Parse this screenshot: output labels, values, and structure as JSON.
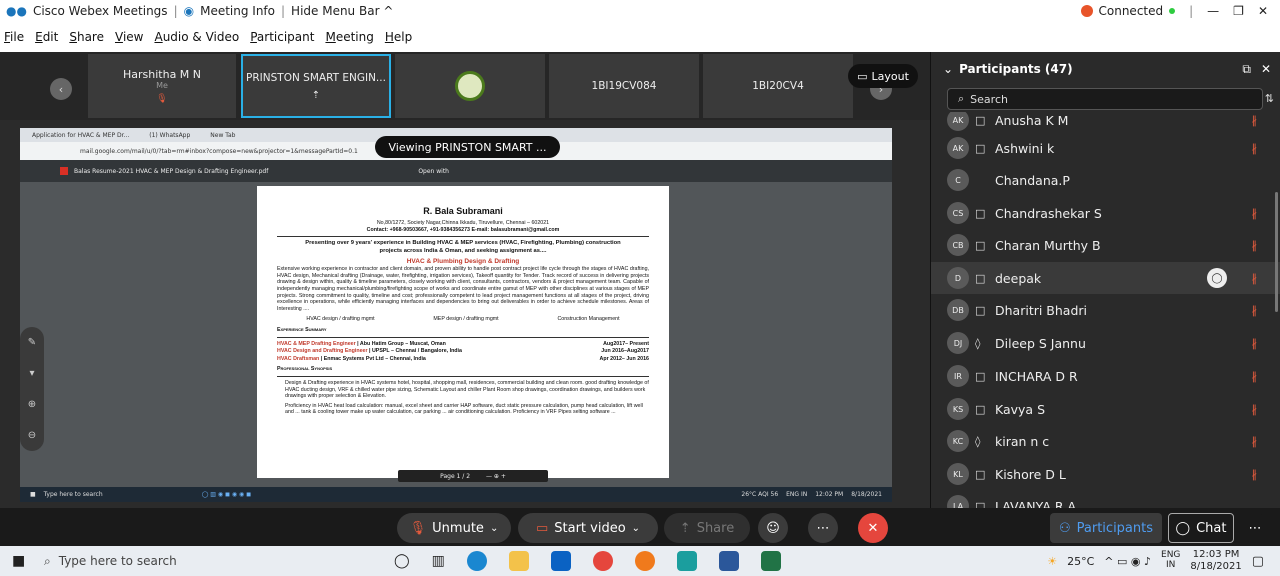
{
  "titlebar": {
    "app": "Cisco Webex Meetings",
    "meeting_info": "Meeting Info",
    "hide_menu": "Hide Menu Bar ^",
    "status": "Connected"
  },
  "menu": [
    "File",
    "Edit",
    "Share",
    "View",
    "Audio & Video",
    "Participant",
    "Meeting",
    "Help"
  ],
  "thumbnails": [
    {
      "name": "Harshitha M N",
      "sub": "Me"
    },
    {
      "name": "PRINSTON SMART ENGIN...",
      "sub": ""
    },
    {
      "name": "",
      "sub": ""
    },
    {
      "name": "1BI19CV084",
      "sub": ""
    },
    {
      "name": "1BI20CV4",
      "sub": ""
    }
  ],
  "layout_label": "Layout",
  "viewing_label": "Viewing PRINSTON SMART ...",
  "shared": {
    "tabs": [
      "Application for HVAC & MEP Dr...",
      "(1) WhatsApp",
      "New Tab"
    ],
    "url": "mail.google.com/mail/u/0/?tab=rm#inbox?compose=new&projector=1&messagePartId=0.1",
    "pdf_title": "Balas Resume-2021 HVAC & MEP Design & Drafting Engineer.pdf",
    "open_with": "Open with",
    "resume": {
      "name": "R. Bala Subramani",
      "address": "No,80/1272, Society Nagar,Chinna Ikkadu, Tiruvellure, Chennai – 602021",
      "contact": "Contact: +968-90503667, +91-9384356273  E-mail: balasubramani@gmail.com",
      "headline": "Presenting over 9 years' experience in Building HVAC & MEP services (HVAC, Firefighting, Plumbing) construction projects across India & Oman, and seeking assignment as....",
      "role": "HVAC & Plumbing Design & Drafting",
      "summary": "Extensive working experience in contractor and client domain, and proven ability to handle post contract project life cycle through the stages of HVAC drafting, HVAC design, Mechanical drafting (Drainage, water, firefighting, irrigation services), Takeoff quantity for Tender. Track record of success in delivering projects drawing & design within, quality & timeline parameters, closely working with client, consultants, contractors, vendors & project management team. Capable of independently managing mechanical/plumbing/firefighting scope of works and coordinate entire gamut of MEP with other disciplines at various stages of MEP projects. Strong commitment to quality, timeline and cost; professionally competent to lead project management functions at all stages of the project, driving excellence in operations, while efficiently managing interfaces and dependencies to bring out deliverables in order to achieve schedule milestones.  Areas of Interesting ....",
      "interests": [
        "HVAC design / drafting mgmt",
        "MEP design / drafting mgmt",
        "Construction Management"
      ],
      "exp_title": "Experience Summary",
      "jobs": [
        {
          "role": "HVAC & MEP Drafting Engineer",
          "org": "Abu Hatim Group – Muscat, Oman",
          "date": "Aug2017– Present"
        },
        {
          "role": "HVAC Design and Drafting Engineer",
          "org": "UPSPL – Chennai / Bangalore, India",
          "date": "Jun 2016–Aug2017"
        },
        {
          "role": "HVAC Draftsman",
          "org": "Enmac Systems Pvt Ltd – Chennai, India",
          "date": "Apr 2012– Jun 2016"
        }
      ],
      "syn_title": "Professional Synopsis",
      "synopsis": [
        "Design & Drafting experience in HVAC systems hotel, hospital, shopping mall, residences, commercial building and clean room. good drafting knowledge of HVAC ducting design, VRF & chilled water pipe sizing, Schematic Layout and chiller Plant Room shop drawings, coordination drawings, and builders work drawings with proper selection & Elevation.",
        "Proficiency in HVAC heat load calculation: manual, excel sheet and carrier HAP software, duct static pressure calculation, pump head calculation, lift well and ... tank & cooling tower make up water calculation, car parking ... air conditioning calculation. Proficiency in VRF Pipes selting software ..."
      ]
    },
    "page_nav": "Page  1  /  2",
    "inner_taskbar": {
      "search": "Type here to search",
      "weather": "26°C  AQI 56",
      "time": "12:02 PM",
      "date": "8/18/2021",
      "lang": "ENG IN"
    }
  },
  "panel": {
    "title": "Participants (47)",
    "search_placeholder": "Search",
    "participants": [
      {
        "initials": "AK",
        "name": "Anusha K M",
        "icon": "□",
        "muted": true
      },
      {
        "initials": "AK",
        "name": "Ashwini k",
        "icon": "□",
        "muted": true
      },
      {
        "initials": "C",
        "name": "Chandana.P",
        "icon": "",
        "muted": false
      },
      {
        "initials": "CS",
        "name": "Chandrashekar S",
        "icon": "□",
        "muted": true
      },
      {
        "initials": "CB",
        "name": "Charan Murthy B",
        "icon": "□",
        "muted": true
      },
      {
        "initials": "D",
        "name": "deepak",
        "icon": "□",
        "muted": true
      },
      {
        "initials": "DB",
        "name": "Dharitri Bhadri",
        "icon": "□",
        "muted": true
      },
      {
        "initials": "DJ",
        "name": "Dileep S Jannu",
        "icon": "◊",
        "muted": true
      },
      {
        "initials": "IR",
        "name": "INCHARA D R",
        "icon": "□",
        "muted": true
      },
      {
        "initials": "KS",
        "name": "Kavya S",
        "icon": "□",
        "muted": true
      },
      {
        "initials": "KC",
        "name": "kiran n c",
        "icon": "◊",
        "muted": true
      },
      {
        "initials": "KL",
        "name": "Kishore D L",
        "icon": "□",
        "muted": true
      },
      {
        "initials": "LA",
        "name": "LAVANYA R A",
        "icon": "□",
        "muted": true
      }
    ]
  },
  "controls": {
    "unmute": "Unmute",
    "start_video": "Start video",
    "share": "Share",
    "participants": "Participants",
    "chat": "Chat"
  },
  "taskbar": {
    "search": "Type here to search",
    "weather": "25°C",
    "lang_top": "ENG",
    "lang_bottom": "IN",
    "time": "12:03 PM",
    "date": "8/18/2021"
  }
}
